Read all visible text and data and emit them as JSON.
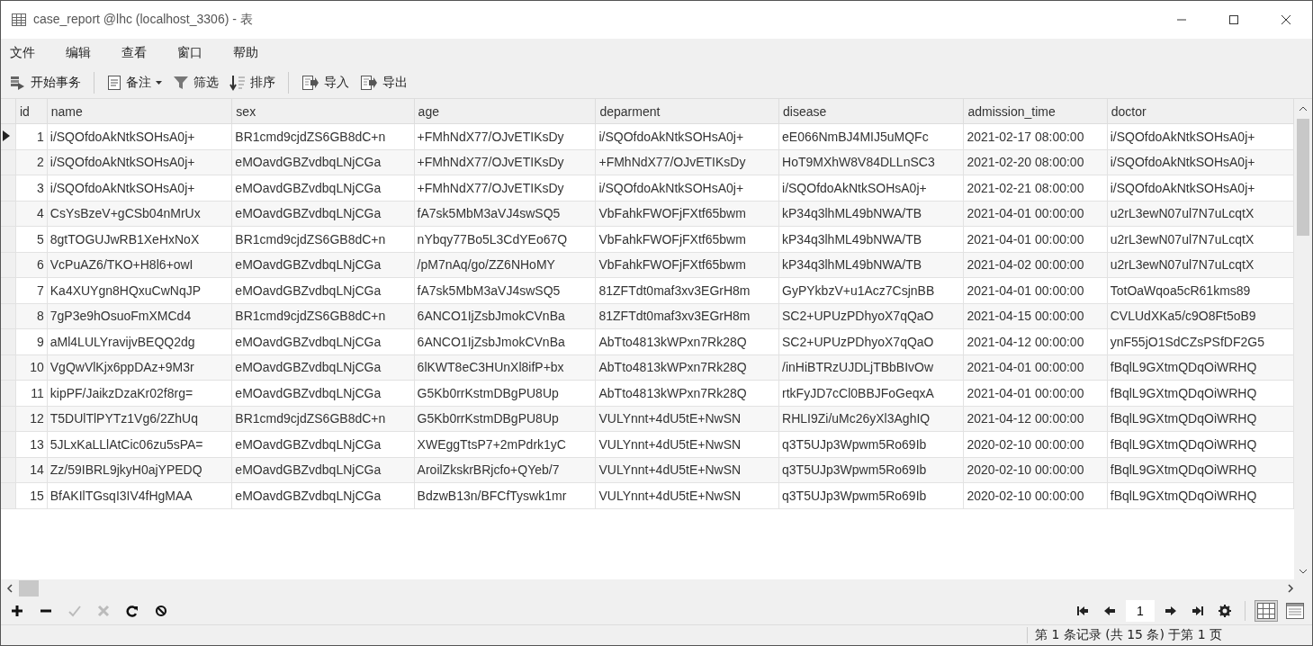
{
  "window": {
    "title": "case_report @lhc (localhost_3306) - 表"
  },
  "menu": [
    "文件",
    "编辑",
    "查看",
    "窗口",
    "帮助"
  ],
  "toolbar": [
    {
      "kind": "transaction",
      "label": "开始事务"
    },
    {
      "kind": "comment",
      "label": "备注",
      "dropdown": true
    },
    {
      "kind": "filter",
      "label": "筛选"
    },
    {
      "kind": "sort",
      "label": "排序"
    },
    {
      "kind": "import",
      "label": "导入"
    },
    {
      "kind": "export",
      "label": "导出"
    }
  ],
  "table": {
    "columns": [
      "id",
      "name",
      "sex",
      "age",
      "deparment",
      "disease",
      "admission_time",
      "doctor"
    ],
    "rows": [
      {
        "selected": true,
        "cells": [
          "1",
          "i/SQOfdoAkNtkSOHsA0j+",
          "BR1cmd9cjdZS6GB8dC+n",
          "+FMhNdX77/OJvETIKsDy",
          "i/SQOfdoAkNtkSOHsA0j+",
          "eE066NmBJ4MIJ5uMQFc",
          "2021-02-17 08:00:00",
          "i/SQOfdoAkNtkSOHsA0j+"
        ]
      },
      {
        "selected": false,
        "cells": [
          "2",
          "i/SQOfdoAkNtkSOHsA0j+",
          "eMOavdGBZvdbqLNjCGa",
          "+FMhNdX77/OJvETIKsDy",
          "+FMhNdX77/OJvETIKsDy",
          "HoT9MXhW8V84DLLnSC3",
          "2021-02-20 08:00:00",
          "i/SQOfdoAkNtkSOHsA0j+"
        ]
      },
      {
        "selected": false,
        "cells": [
          "3",
          "i/SQOfdoAkNtkSOHsA0j+",
          "eMOavdGBZvdbqLNjCGa",
          "+FMhNdX77/OJvETIKsDy",
          "i/SQOfdoAkNtkSOHsA0j+",
          "i/SQOfdoAkNtkSOHsA0j+",
          "2021-02-21 08:00:00",
          "i/SQOfdoAkNtkSOHsA0j+"
        ]
      },
      {
        "selected": false,
        "cells": [
          "4",
          "CsYsBzeV+gCSb04nMrUx",
          "eMOavdGBZvdbqLNjCGa",
          "fA7sk5MbM3aVJ4swSQ5",
          "VbFahkFWOFjFXtf65bwm",
          "kP34q3lhML49bNWA/TB",
          "2021-04-01 00:00:00",
          "u2rL3ewN07ul7N7uLcqtX"
        ]
      },
      {
        "selected": false,
        "cells": [
          "5",
          "8gtTOGUJwRB1XeHxNoX",
          "BR1cmd9cjdZS6GB8dC+n",
          "nYbqy77Bo5L3CdYEo67Q",
          "VbFahkFWOFjFXtf65bwm",
          "kP34q3lhML49bNWA/TB",
          "2021-04-01 00:00:00",
          "u2rL3ewN07ul7N7uLcqtX"
        ]
      },
      {
        "selected": false,
        "cells": [
          "6",
          "VcPuAZ6/TKO+H8l6+owI",
          "eMOavdGBZvdbqLNjCGa",
          "/pM7nAq/go/ZZ6NHoMY",
          "VbFahkFWOFjFXtf65bwm",
          "kP34q3lhML49bNWA/TB",
          "2021-04-02 00:00:00",
          "u2rL3ewN07ul7N7uLcqtX"
        ]
      },
      {
        "selected": false,
        "cells": [
          "7",
          "Ka4XUYgn8HQxuCwNqJP",
          "eMOavdGBZvdbqLNjCGa",
          "fA7sk5MbM3aVJ4swSQ5",
          "81ZFTdt0maf3xv3EGrH8m",
          "GyPYkbzV+u1Acz7CsjnBB",
          "2021-04-01 00:00:00",
          "TotOaWqoa5cR61kms89"
        ]
      },
      {
        "selected": false,
        "cells": [
          "8",
          "7gP3e9hOsuoFmXMCd4",
          "BR1cmd9cjdZS6GB8dC+n",
          "6ANCO1IjZsbJmokCVnBa",
          "81ZFTdt0maf3xv3EGrH8m",
          "SC2+UPUzPDhyoX7qQaO",
          "2021-04-15 00:00:00",
          "CVLUdXKa5/c9O8Ft5oB9"
        ]
      },
      {
        "selected": false,
        "cells": [
          "9",
          "aMl4LULYravijvBEQQ2dg",
          "eMOavdGBZvdbqLNjCGa",
          "6ANCO1IjZsbJmokCVnBa",
          "AbTto4813kWPxn7Rk28Q",
          "SC2+UPUzPDhyoX7qQaO",
          "2021-04-12 00:00:00",
          "ynF55jO1SdCZsPSfDF2G5"
        ]
      },
      {
        "selected": false,
        "cells": [
          "10",
          "VgQwVlKjx6ppDAz+9M3r",
          "eMOavdGBZvdbqLNjCGa",
          "6lKWT8eC3HUnXl8ifP+bx",
          "AbTto4813kWPxn7Rk28Q",
          "/inHiBTRzUJDLjTBbBIvOw",
          "2021-04-01 00:00:00",
          "fBqlL9GXtmQDqOiWRHQ"
        ]
      },
      {
        "selected": false,
        "cells": [
          "11",
          "kipPF/JaikzDzaKr02f8rg=",
          "eMOavdGBZvdbqLNjCGa",
          "G5Kb0rrKstmDBgPU8Up",
          "AbTto4813kWPxn7Rk28Q",
          "rtkFyJD7cCl0BBJFoGeqxA",
          "2021-04-01 00:00:00",
          "fBqlL9GXtmQDqOiWRHQ"
        ]
      },
      {
        "selected": false,
        "cells": [
          "12",
          "T5DUlTlPYTz1Vg6/2ZhUq",
          "BR1cmd9cjdZS6GB8dC+n",
          "G5Kb0rrKstmDBgPU8Up",
          "VULYnnt+4dU5tE+NwSN",
          "RHLI9Zi/uMc26yXl3AghIQ",
          "2021-04-12 00:00:00",
          "fBqlL9GXtmQDqOiWRHQ"
        ]
      },
      {
        "selected": false,
        "cells": [
          "13",
          "5JLxKaLLlAtCic06zu5sPA=",
          "eMOavdGBZvdbqLNjCGa",
          "XWEggTtsP7+2mPdrk1yC",
          "VULYnnt+4dU5tE+NwSN",
          "q3T5UJp3Wpwm5Ro69Ib",
          "2020-02-10 00:00:00",
          "fBqlL9GXtmQDqOiWRHQ"
        ]
      },
      {
        "selected": false,
        "cells": [
          "14",
          "Zz/59IBRL9jkyH0ajYPEDQ",
          "eMOavdGBZvdbqLNjCGa",
          "AroilZkskrBRjcfo+QYeb/7",
          "VULYnnt+4dU5tE+NwSN",
          "q3T5UJp3Wpwm5Ro69Ib",
          "2020-02-10 00:00:00",
          "fBqlL9GXtmQDqOiWRHQ"
        ]
      },
      {
        "selected": false,
        "cells": [
          "15",
          "BfAKIlTGsqI3IV4fHgMAA",
          "eMOavdGBZvdbqLNjCGa",
          "BdzwB13n/BFCfTyswk1mr",
          "VULYnnt+4dU5tE+NwSN",
          "q3T5UJp3Wpwm5Ro69Ib",
          "2020-02-10 00:00:00",
          "fBqlL9GXtmQDqOiWRHQ"
        ]
      }
    ]
  },
  "record_buttons": [
    {
      "kind": "add",
      "disabled": false
    },
    {
      "kind": "delete",
      "disabled": false
    },
    {
      "kind": "apply",
      "disabled": true
    },
    {
      "kind": "discard",
      "disabled": true
    },
    {
      "kind": "refresh",
      "disabled": false
    },
    {
      "kind": "stop",
      "disabled": false
    }
  ],
  "pager": {
    "page": "1"
  },
  "views": [
    {
      "kind": "grid",
      "selected": true
    },
    {
      "kind": "form",
      "selected": false
    }
  ],
  "status_bar": "第 1 条记录 (共 15 条) 于第 1 页"
}
